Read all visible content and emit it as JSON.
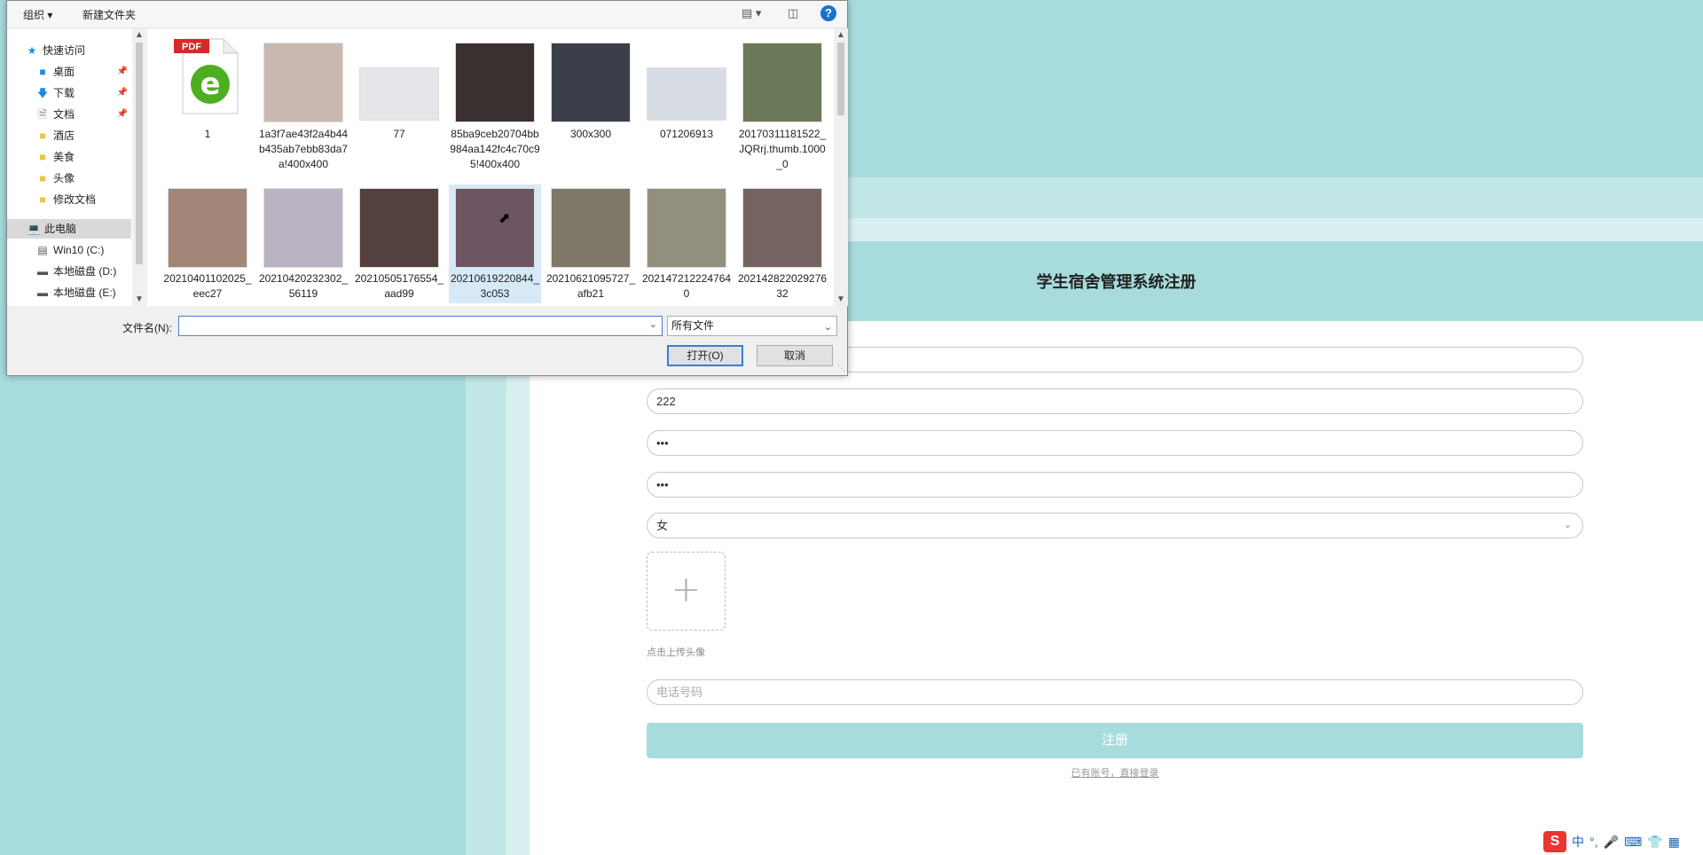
{
  "page": {
    "title": "学生宿舍管理系统注册",
    "fields": [
      {
        "value": "",
        "placeholder": ""
      },
      {
        "value": "222",
        "placeholder": ""
      },
      {
        "value": "•••",
        "placeholder": ""
      },
      {
        "value": "•••",
        "placeholder": ""
      }
    ],
    "gender": "女",
    "upload_tip": "点击上传头像",
    "phone_placeholder": "电话号码",
    "register_label": "注册",
    "login_link": "已有账号，直接登录",
    "accent_color": "#a8dcdc"
  },
  "ime": {
    "lang": "中",
    "punct": "°,"
  },
  "dialog": {
    "toolbar": {
      "organize": "组织 ▾",
      "new_folder": "新建文件夹",
      "help": "?"
    },
    "nav": [
      {
        "label": "快速访问",
        "icon": "star-icon"
      },
      {
        "label": "桌面",
        "icon": "desktop-icon",
        "pinned": true
      },
      {
        "label": "下载",
        "icon": "download-icon",
        "pinned": true
      },
      {
        "label": "文档",
        "icon": "document-icon",
        "pinned": true
      },
      {
        "label": "酒店",
        "icon": "folder-icon"
      },
      {
        "label": "美食",
        "icon": "folder-icon"
      },
      {
        "label": "头像",
        "icon": "folder-icon"
      },
      {
        "label": "修改文档",
        "icon": "folder-icon"
      },
      {
        "label": "此电脑",
        "icon": "computer-icon"
      },
      {
        "label": "Win10 (C:)",
        "icon": "drive-icon"
      },
      {
        "label": "本地磁盘 (D:)",
        "icon": "drive-icon"
      },
      {
        "label": "本地磁盘 (E:)",
        "icon": "drive-icon"
      }
    ],
    "files": [
      {
        "name": "1",
        "kind": "pdf"
      },
      {
        "name": "1a3f7ae43f2a4b44b435ab7ebb83da7a!400x400",
        "kind": "photo",
        "color": "#c9b8b0"
      },
      {
        "name": "77",
        "kind": "photo",
        "color": "#e6e6ea"
      },
      {
        "name": "85ba9ceb20704bb984aa142fc4c70c95!400x400",
        "kind": "photo",
        "color": "#3a3030"
      },
      {
        "name": "300x300",
        "kind": "photo",
        "color": "#3b3f4a"
      },
      {
        "name": "071206913",
        "kind": "photo",
        "color": "#d8dde5"
      },
      {
        "name": "20170311181522_JQRrj.thumb.1000_0",
        "kind": "photo",
        "color": "#6d7a5a"
      },
      {
        "name": "20210401102025_eec27",
        "kind": "photo",
        "color": "#a18677"
      },
      {
        "name": "20210420232302_56119",
        "kind": "photo",
        "color": "#b9b3c4"
      },
      {
        "name": "20210505176554_aad99",
        "kind": "photo",
        "color": "#54403f"
      },
      {
        "name": "20210619220844_3c053",
        "kind": "photo",
        "color": "#6c5560"
      },
      {
        "name": "20210621095727_afb21",
        "kind": "photo",
        "color": "#7f7868"
      },
      {
        "name": "2021472122247640",
        "kind": "photo",
        "color": "#938f7d"
      },
      {
        "name": "20214282202927632",
        "kind": "photo",
        "color": "#736462"
      }
    ],
    "filename_label": "文件名(N):",
    "filename_value": "",
    "filetype": "所有文件",
    "open_label": "打开(O)",
    "cancel_label": "取消"
  }
}
